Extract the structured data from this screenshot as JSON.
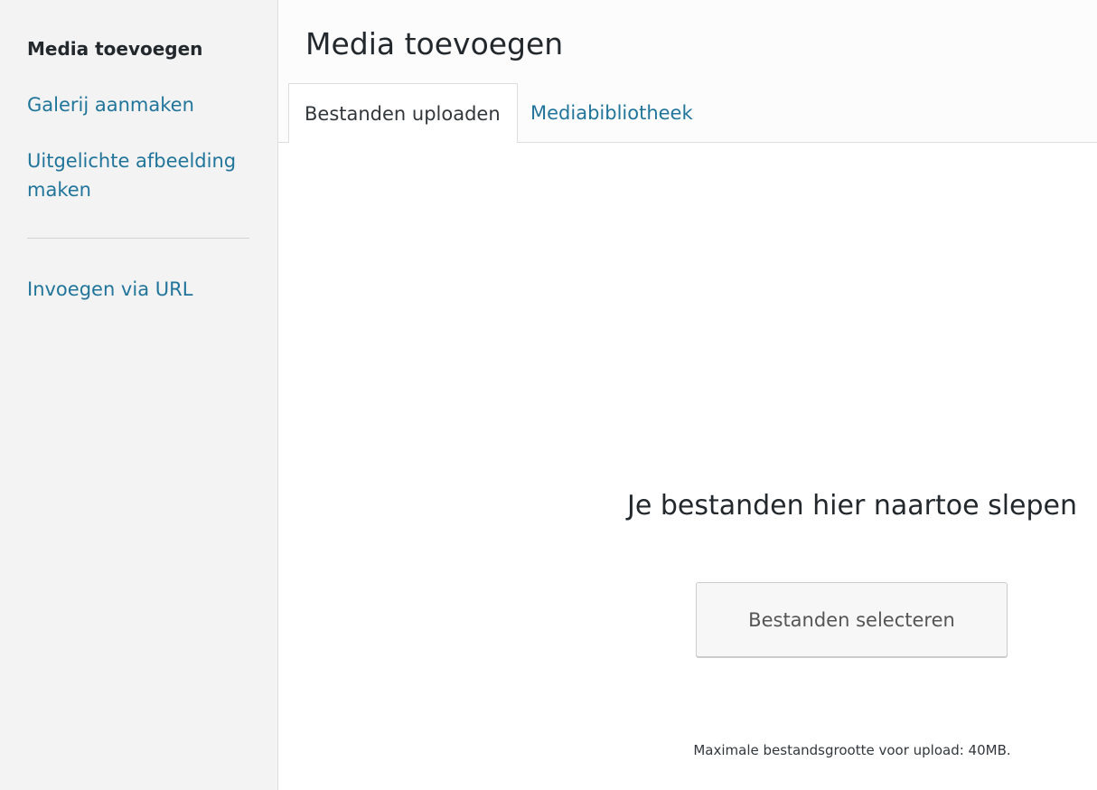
{
  "sidebar": {
    "items": [
      {
        "label": "Media toevoegen",
        "active": true
      },
      {
        "label": "Galerij aanmaken",
        "active": false
      },
      {
        "label": "Uitgelichte afbeelding maken",
        "active": false
      },
      {
        "label": "Invoegen via URL",
        "active": false
      }
    ]
  },
  "header": {
    "title": "Media toevoegen"
  },
  "tabs": [
    {
      "label": "Bestanden uploaden",
      "active": true
    },
    {
      "label": "Mediabibliotheek",
      "active": false
    }
  ],
  "upload": {
    "instructions": "Je bestanden hier naartoe slepen",
    "select_button": "Bestanden selecteren",
    "max_size": "Maximale bestandsgrootte voor upload: 40MB."
  },
  "colors": {
    "link": "#21759b",
    "text": "#23282d",
    "sidebar_bg": "#f3f3f3"
  }
}
